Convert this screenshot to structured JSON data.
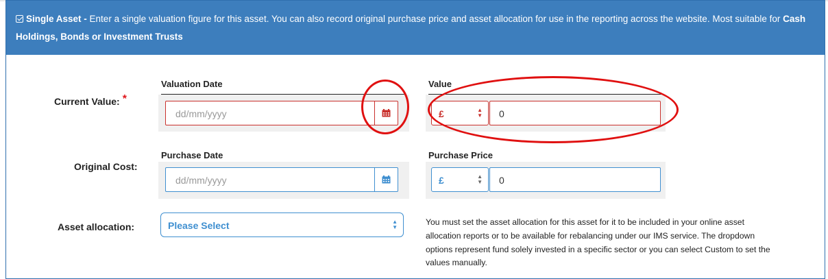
{
  "header": {
    "title_bold": "Single Asset -",
    "description": "Enter a single valuation figure for this asset. You can also record original purchase price and asset allocation for use in the reporting across the website. Most suitable for",
    "suitable_bold": "Cash Holdings, Bonds or Investment Trusts"
  },
  "current_value": {
    "label": "Current Value:",
    "required_mark": "*",
    "date_header": "Valuation Date",
    "date_placeholder": "dd/mm/yyyy",
    "value_header": "Value",
    "currency": "£",
    "amount": "0"
  },
  "original_cost": {
    "label": "Original Cost:",
    "date_header": "Purchase Date",
    "date_placeholder": "dd/mm/yyyy",
    "price_header": "Purchase Price",
    "currency": "£",
    "amount": "0"
  },
  "asset_allocation": {
    "label": "Asset allocation:",
    "selected": "Please Select",
    "help_text": "You must set the asset allocation for this asset for it to be included in your online asset allocation reports or to be available for rebalancing under our IMS service. The dropdown options represent fund solely invested in a specific sector or you can select Custom to set the values manually."
  },
  "colors": {
    "header_bg": "#3d7ebd",
    "error": "#c9302c",
    "focus": "#3f8fd0",
    "annotation": "#e01010"
  }
}
